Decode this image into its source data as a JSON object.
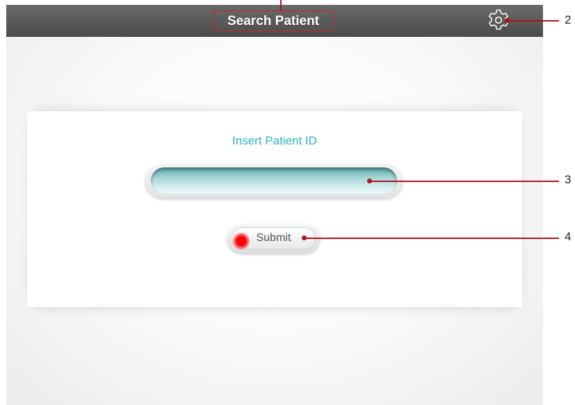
{
  "header": {
    "title": "Search Patient",
    "settings_icon": "gear-icon"
  },
  "form": {
    "label": "Insert Patient ID",
    "patient_id_value": "",
    "submit_label": "Submit"
  },
  "annotations": {
    "callout_2": "2",
    "callout_3": "3",
    "callout_4": "4"
  },
  "colors": {
    "header_bg": "#555555",
    "label_color": "#2ab3c6",
    "callout_color": "#b3121c",
    "touch_indicator": "#ff0000"
  }
}
